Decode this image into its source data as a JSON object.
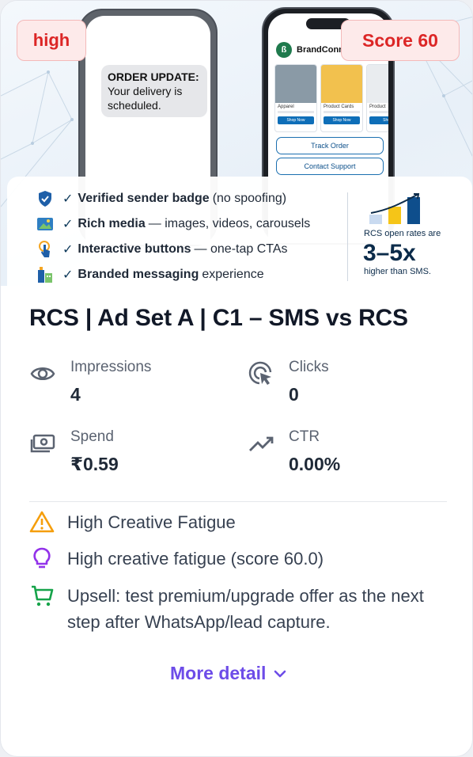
{
  "badges": {
    "level": "high",
    "score": "Score 60"
  },
  "creative": {
    "sms": {
      "line1": "ORDER UPDATE:",
      "line2": "Your delivery is",
      "line3": "scheduled."
    },
    "rcs": {
      "brand": "BrandConn",
      "products": [
        {
          "label": "Apparel",
          "cta": "Shop Now",
          "color": "#8a9aa6"
        },
        {
          "label": "Product Cards",
          "cta": "Shop Now",
          "color": "#f2c14e"
        },
        {
          "label": "Product",
          "cta": "Shop",
          "color": "#e9ecef"
        }
      ],
      "buttons": [
        "Track Order",
        "Contact Support"
      ]
    },
    "features": [
      {
        "icon": "shield-check-icon",
        "bold": "Verified sender badge",
        "rest": "(no spoofing)"
      },
      {
        "icon": "image-icon",
        "bold": "Rich media",
        "rest": "— images, videos, carousels"
      },
      {
        "icon": "tap-icon",
        "bold": "Interactive buttons",
        "rest": "— one-tap CTAs"
      },
      {
        "icon": "building-icon",
        "bold": "Branded messaging",
        "rest": "experience"
      }
    ],
    "stat": {
      "small": "RCS open rates are",
      "big": "3–5x",
      "sub": "higher than SMS."
    }
  },
  "title": "RCS | Ad Set A | C1 – SMS vs RCS",
  "metrics": [
    {
      "icon": "eye-icon",
      "label": "Impressions",
      "value": "4"
    },
    {
      "icon": "cursor-click-icon",
      "label": "Clicks",
      "value": "0"
    },
    {
      "icon": "cash-icon",
      "label": "Spend",
      "value": "₹0.59"
    },
    {
      "icon": "trend-up-icon",
      "label": "CTR",
      "value": "0.00%"
    }
  ],
  "notes": [
    {
      "icon": "warning-icon",
      "text": "High Creative Fatigue",
      "color": "#f59e0b"
    },
    {
      "icon": "lightbulb-icon",
      "text": "High creative fatigue (score 60.0)",
      "color": "#9333ea"
    },
    {
      "icon": "cart-icon",
      "text": "Upsell: test premium/upgrade offer as the next step after WhatsApp/lead capture.",
      "color": "#16a34a"
    }
  ],
  "more_label": "More detail",
  "colors": {
    "accent": "#6d4ce8",
    "badge_red": "#dc2626"
  }
}
